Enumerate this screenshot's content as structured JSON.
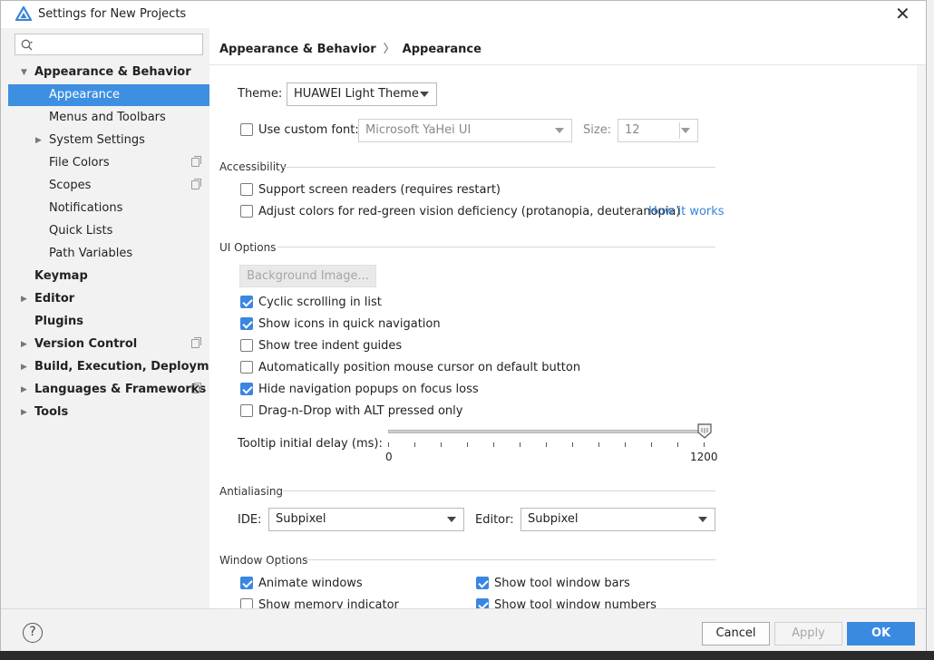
{
  "window": {
    "title": "Settings for New Projects"
  },
  "sidebar": {
    "search": {
      "placeholder": ""
    },
    "items": [
      {
        "label": "Appearance & Behavior"
      },
      {
        "label": "Appearance"
      },
      {
        "label": "Menus and Toolbars"
      },
      {
        "label": "System Settings"
      },
      {
        "label": "File Colors"
      },
      {
        "label": "Scopes"
      },
      {
        "label": "Notifications"
      },
      {
        "label": "Quick Lists"
      },
      {
        "label": "Path Variables"
      },
      {
        "label": "Keymap"
      },
      {
        "label": "Editor"
      },
      {
        "label": "Plugins"
      },
      {
        "label": "Version Control"
      },
      {
        "label": "Build, Execution, Deployment"
      },
      {
        "label": "Languages & Frameworks"
      },
      {
        "label": "Tools"
      }
    ]
  },
  "breadcrumb": {
    "parent": "Appearance & Behavior",
    "separator": "〉",
    "current": "Appearance"
  },
  "theme": {
    "label": "Theme:",
    "value": "HUAWEI Light Theme"
  },
  "font": {
    "label": "Use custom font:",
    "checked": false,
    "value": "Microsoft YaHei UI",
    "size_label": "Size:",
    "size_value": "12"
  },
  "accessibility": {
    "header": "Accessibility",
    "screen_readers": "Support screen readers (requires restart)",
    "adjust_colors": "Adjust colors for red-green vision deficiency (protanopia, deuteranopia)",
    "how_it_works": "How it works"
  },
  "ui_options": {
    "header": "UI Options",
    "background_image": "Background Image...",
    "cyclic_scrolling": "Cyclic scrolling in list",
    "show_icons": "Show icons in quick navigation",
    "tree_indent": "Show tree indent guides",
    "auto_mouse": "Automatically position mouse cursor on default button",
    "hide_popups": "Hide navigation popups on focus loss",
    "drag_drop": "Drag-n-Drop with ALT pressed only",
    "tooltip_label": "Tooltip initial delay (ms):",
    "tooltip_min": "0",
    "tooltip_max": "1200",
    "tooltip_value": 1200
  },
  "antialiasing": {
    "header": "Antialiasing",
    "ide_label": "IDE:",
    "ide_value": "Subpixel",
    "editor_label": "Editor:",
    "editor_value": "Subpixel"
  },
  "window_options": {
    "header": "Window Options",
    "animate": "Animate windows",
    "memory": "Show memory indicator",
    "tool_bars": "Show tool window bars",
    "tool_numbers": "Show tool window numbers"
  },
  "footer": {
    "help": "?",
    "cancel": "Cancel",
    "apply": "Apply",
    "ok": "OK"
  },
  "colors": {
    "accent": "#3d8fe1",
    "link": "#3a83d6"
  }
}
